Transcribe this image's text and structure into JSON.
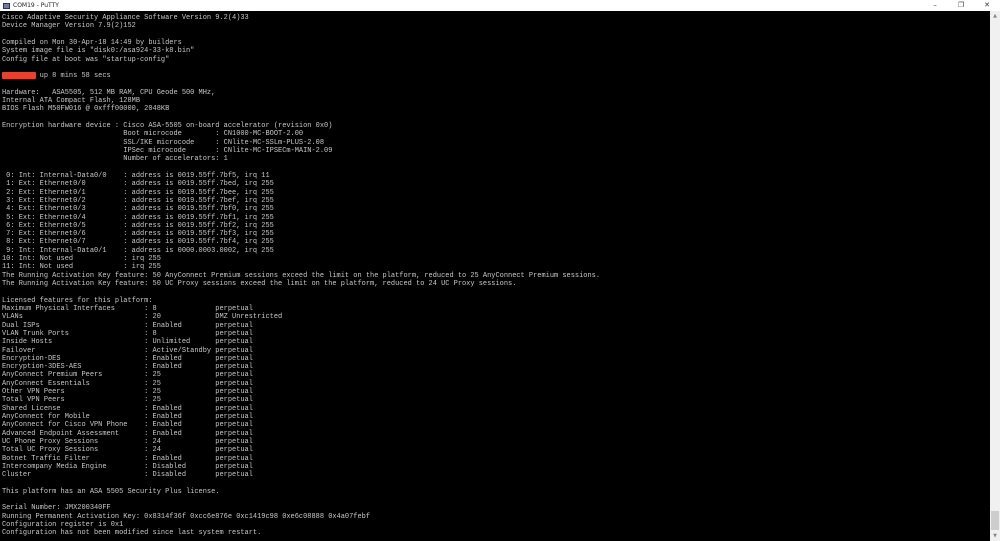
{
  "window": {
    "title": "COM19 - PuTTY",
    "minimize": "–",
    "maximize": "❐",
    "close": "✕"
  },
  "scrollbar": {
    "up": "▲",
    "down": "▼"
  },
  "terminal": {
    "lines": [
      "Cisco Adaptive Security Appliance Software Version 9.2(4)33",
      "Device Manager Version 7.9(2)152",
      "",
      "Compiled on Mon 30-Apr-18 14:49 by builders",
      "System image file is \"disk0:/asa924-33-k8.bin\"",
      "Config file at boot was \"startup-config\"",
      "",
      "         up 8 mins 58 secs",
      "",
      "Hardware:   ASA5505, 512 MB RAM, CPU Geode 500 MHz,",
      "Internal ATA Compact Flash, 128MB",
      "BIOS Flash M50FW016 @ 0xfff00000, 2048KB",
      "",
      "Encryption hardware device : Cisco ASA-5505 on-board accelerator (revision 0x0)",
      "                             Boot microcode        : CN1000-MC-BOOT-2.00",
      "                             SSL/IKE microcode     : CNlite-MC-SSLm-PLUS-2.08",
      "                             IPSec microcode       : CNlite-MC-IPSECm-MAIN-2.09",
      "                             Number of accelerators: 1",
      "",
      " 0: Int: Internal-Data0/0    : address is 0019.55ff.7bf5, irq 11",
      " 1: Ext: Ethernet0/0         : address is 0019.55ff.7bed, irq 255",
      " 2: Ext: Ethernet0/1         : address is 0019.55ff.7bee, irq 255",
      " 3: Ext: Ethernet0/2         : address is 0019.55ff.7bef, irq 255",
      " 4: Ext: Ethernet0/3         : address is 0019.55ff.7bf0, irq 255",
      " 5: Ext: Ethernet0/4         : address is 0019.55ff.7bf1, irq 255",
      " 6: Ext: Ethernet0/5         : address is 0019.55ff.7bf2, irq 255",
      " 7: Ext: Ethernet0/6         : address is 0019.55ff.7bf3, irq 255",
      " 8: Ext: Ethernet0/7         : address is 0019.55ff.7bf4, irq 255",
      " 9: Int: Internal-Data0/1    : address is 0000.0003.0002, irq 255",
      "10: Int: Not used            : irq 255",
      "11: Int: Not used            : irq 255",
      "The Running Activation Key feature: 50 AnyConnect Premium sessions exceed the limit on the platform, reduced to 25 AnyConnect Premium sessions.",
      "The Running Activation Key feature: 50 UC Proxy sessions exceed the limit on the platform, reduced to 24 UC Proxy sessions.",
      "",
      "Licensed features for this platform:",
      "Maximum Physical Interfaces       : 8              perpetual",
      "VLANs                             : 20             DMZ Unrestricted",
      "Dual ISPs                         : Enabled        perpetual",
      "VLAN Trunk Ports                  : 8              perpetual",
      "Inside Hosts                      : Unlimited      perpetual",
      "Failover                          : Active/Standby perpetual",
      "Encryption-DES                    : Enabled        perpetual",
      "Encryption-3DES-AES               : Enabled        perpetual",
      "AnyConnect Premium Peers          : 25             perpetual",
      "AnyConnect Essentials             : 25             perpetual",
      "Other VPN Peers                   : 25             perpetual",
      "Total VPN Peers                   : 25             perpetual",
      "Shared License                    : Enabled        perpetual",
      "AnyConnect for Mobile             : Enabled        perpetual",
      "AnyConnect for Cisco VPN Phone    : Enabled        perpetual",
      "Advanced Endpoint Assessment      : Enabled        perpetual",
      "UC Phone Proxy Sessions           : 24             perpetual",
      "Total UC Proxy Sessions           : 24             perpetual",
      "Botnet Traffic Filter             : Enabled        perpetual",
      "Intercompany Media Engine         : Disabled       perpetual",
      "Cluster                           : Disabled       perpetual",
      "",
      "This platform has an ASA 5505 Security Plus license.",
      "",
      "Serial Number: JMX200340FF",
      "Running Permanent Activation Key: 0x8314f36f 0xcc6e876e 0xc1419c98 0xe6c08888 0x4a07febf",
      "Configuration register is 0x1",
      "Configuration has not been modified since last system restart."
    ]
  }
}
